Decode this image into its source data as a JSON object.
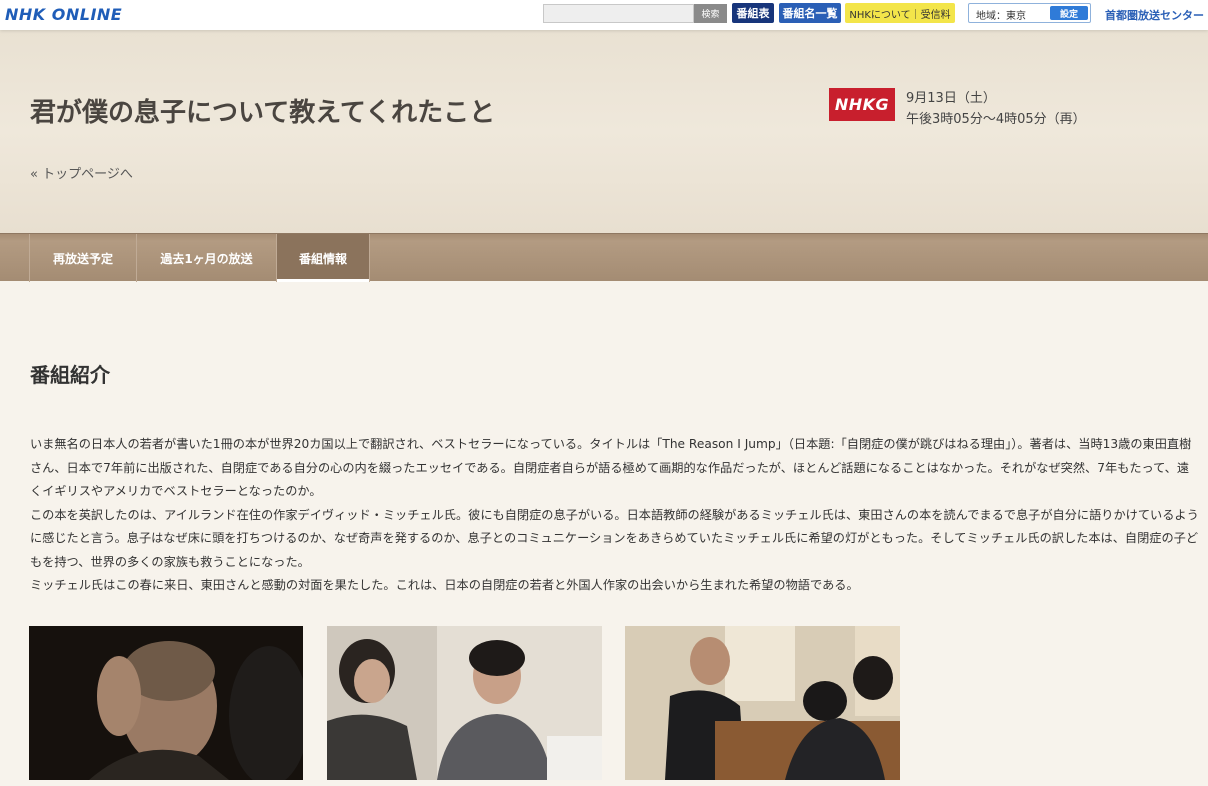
{
  "topbar": {
    "logo": "NHK ONLINE",
    "search_button": "検索",
    "schedule_button": "番組表",
    "program_list_button": "番組名一覧",
    "about_button": "NHKについて｜受信料",
    "region_label": "地域：東京",
    "region_set_button": "設定",
    "center_link": "首都圏放送センター"
  },
  "header": {
    "title": "君が僕の息子について教えてくれたこと",
    "top_link": "« トップページへ",
    "channel": "NHKG",
    "air_date": "9月13日（土）",
    "air_time": "午後3時05分～4時05分（再）"
  },
  "tabs": [
    {
      "label": "再放送予定"
    },
    {
      "label": "過去1ヶ月の放送"
    },
    {
      "label": "番組情報"
    }
  ],
  "content": {
    "section_title": "番組紹介",
    "paragraphs": [
      "いま無名の日本人の若者が書いた1冊の本が世界20カ国以上で翻訳され、ベストセラーになっている。タイトルは「The Reason I Jump」（日本題:「自閉症の僕が跳びはねる理由」）。著者は、当時13歳の東田直樹さん、日本で7年前に出版された、自閉症である自分の心の内を綴ったエッセイである。自閉症者自らが語る極めて画期的な作品だったが、ほとんど話題になることはなかった。それがなぜ突然、7年もたって、遠くイギリスやアメリカでベストセラーとなったのか。",
      "この本を英訳したのは、アイルランド在住の作家デイヴィッド・ミッチェル氏。彼にも自閉症の息子がいる。日本語教師の経験があるミッチェル氏は、東田さんの本を読んでまるで息子が自分に語りかけているように感じたと言う。息子はなぜ床に頭を打ちつけるのか、なぜ奇声を発するのか、息子とのコミュニケーションをあきらめていたミッチェル氏に希望の灯がともった。そしてミッチェル氏の訳した本は、自閉症の子どもを持つ、世界の多くの家族も救うことになった。",
      "ミッチェル氏はこの春に来日、東田さんと感動の対面を果たした。これは、日本の自閉症の若者と外国人作家の出会いから生まれた希望の物語である。"
    ]
  },
  "colors": {
    "logo_blue": "#1f5db8",
    "channel_red": "#c81f2d",
    "tab_brown": "#a68d74",
    "active_tab": "#8b735c"
  }
}
